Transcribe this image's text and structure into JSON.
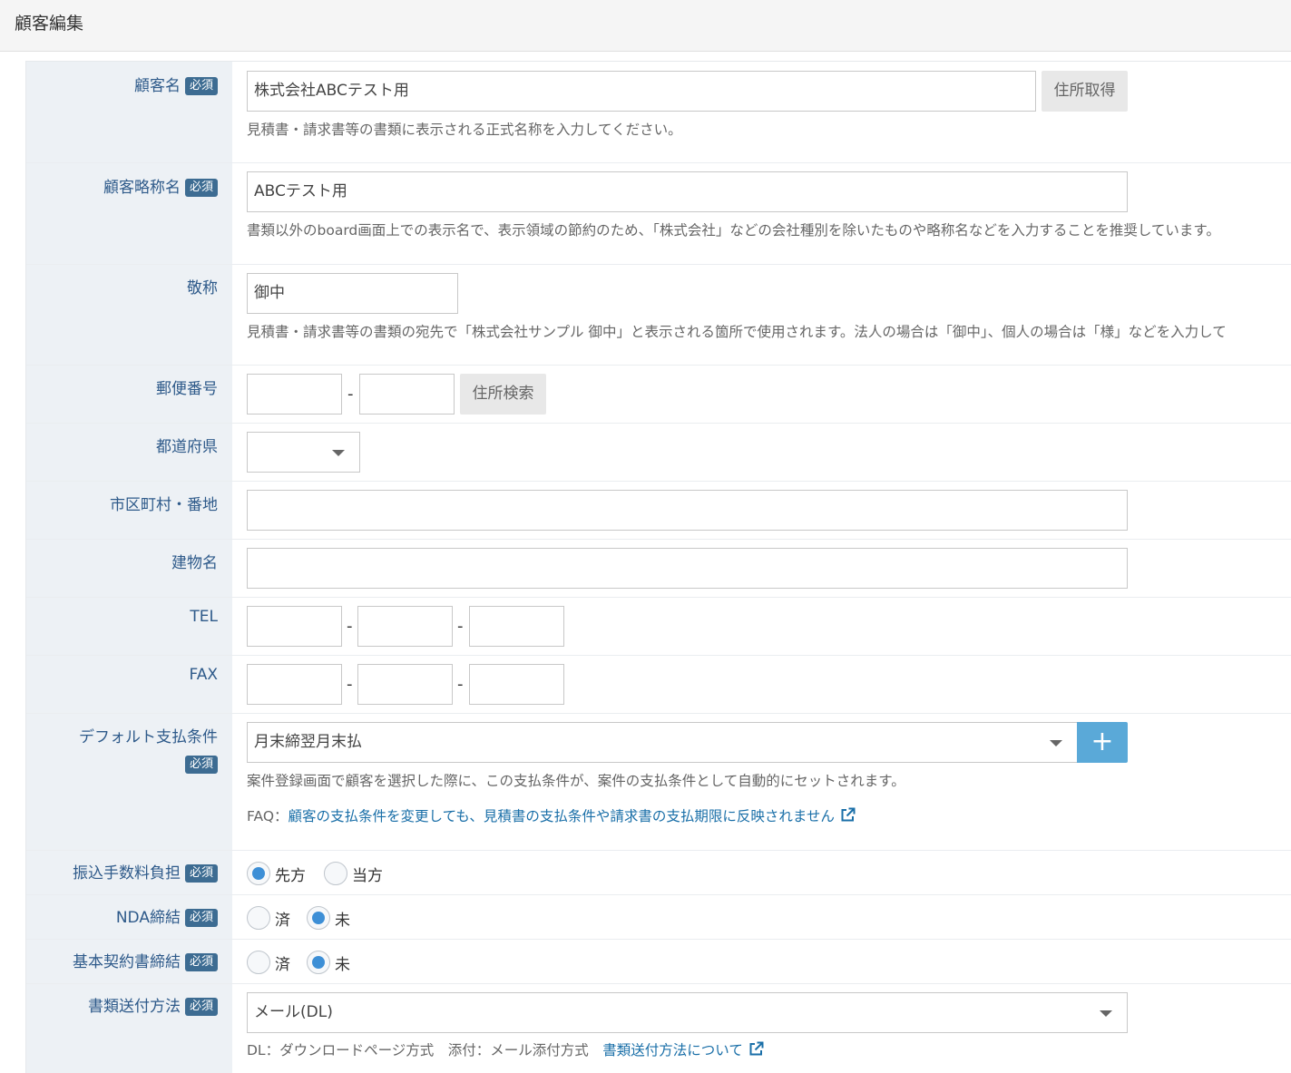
{
  "header": {
    "title": "顧客編集"
  },
  "required_badge": "必須",
  "fields": {
    "customer_name": {
      "label": "顧客名",
      "value": "株式会社ABCテスト用",
      "button": "住所取得",
      "help": "見積書・請求書等の書類に表示される正式名称を入力してください。"
    },
    "short_name": {
      "label": "顧客略称名",
      "value": "ABCテスト用",
      "help": "書類以外のboard画面上での表示名で、表示領域の節約のため、「株式会社」などの会社種別を除いたものや略称名などを入力することを推奨しています。"
    },
    "honorific": {
      "label": "敬称",
      "value": "御中",
      "help": "見積書・請求書等の書類の宛先で「株式会社サンプル 御中」と表示される箇所で使用されます。法人の場合は「御中」、個人の場合は「様」などを入力して"
    },
    "postal_code": {
      "label": "郵便番号",
      "part1": "",
      "part2": "",
      "separator": "-",
      "button": "住所検索"
    },
    "prefecture": {
      "label": "都道府県",
      "value": ""
    },
    "city": {
      "label": "市区町村・番地",
      "value": ""
    },
    "building": {
      "label": "建物名",
      "value": ""
    },
    "tel": {
      "label": "TEL",
      "parts": [
        "",
        "",
        ""
      ],
      "separator": "-"
    },
    "fax": {
      "label": "FAX",
      "parts": [
        "",
        "",
        ""
      ],
      "separator": "-"
    },
    "payment_terms": {
      "label": "デフォルト支払条件",
      "value": "月末締翌月末払",
      "add_button": "+",
      "help": "案件登録画面で顧客を選択した際に、この支払条件が、案件の支払条件として自動的にセットされます。",
      "faq_prefix": "FAQ：",
      "faq_link": "顧客の支払条件を変更しても、見積書の支払条件や請求書の支払期限に反映されません"
    },
    "transfer_fee": {
      "label": "振込手数料負担",
      "options": [
        {
          "label": "先方",
          "selected": true
        },
        {
          "label": "当方",
          "selected": false
        }
      ]
    },
    "nda": {
      "label": "NDA締結",
      "options": [
        {
          "label": "済",
          "selected": false
        },
        {
          "label": "未",
          "selected": true
        }
      ]
    },
    "basic_contract": {
      "label": "基本契約書締結",
      "options": [
        {
          "label": "済",
          "selected": false
        },
        {
          "label": "未",
          "selected": true
        }
      ]
    },
    "delivery_method": {
      "label": "書類送付方法",
      "value": "メール(DL)",
      "help": "DL：ダウンロードページ方式　添付：メール添付方式",
      "help_link": "書類送付方法について"
    }
  },
  "colors": {
    "label_bg": "#edf1f5",
    "label_text": "#2e5a8a",
    "badge": "#3d6c92",
    "accent": "#5aa9d8",
    "radio_on": "#3d8fd6",
    "link": "#1a6fa8"
  }
}
